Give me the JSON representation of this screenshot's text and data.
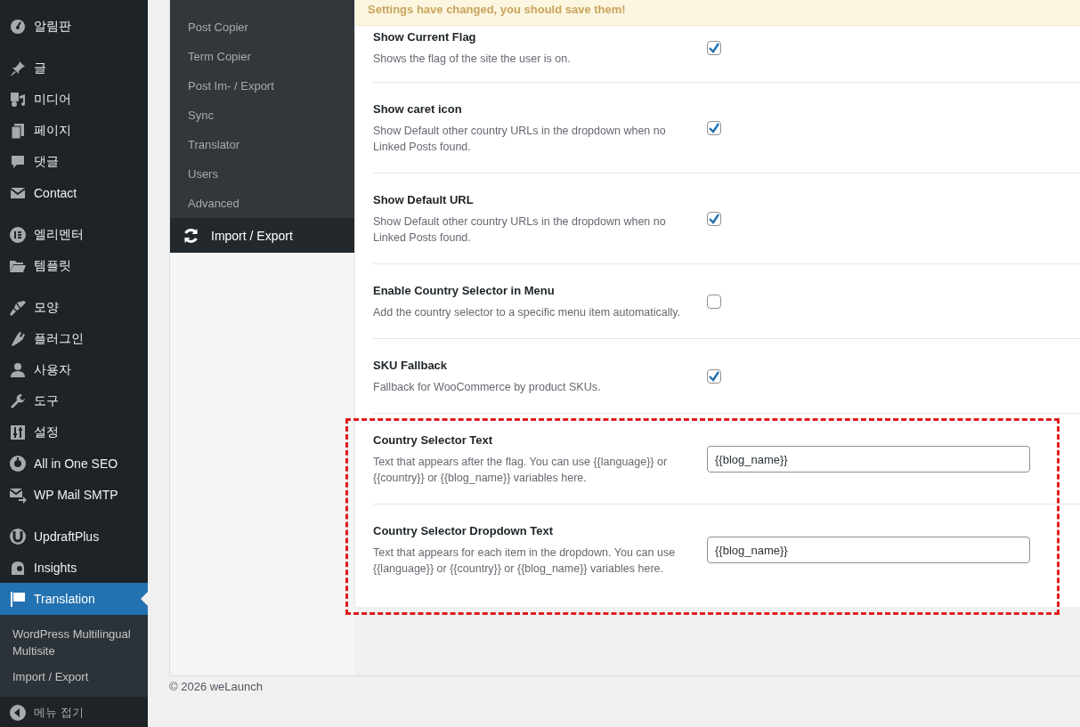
{
  "sidebar": {
    "groups": [
      [
        {
          "label": "알림판",
          "selected": false
        }
      ],
      [
        {
          "label": "글",
          "selected": false
        },
        {
          "label": "미디어",
          "selected": false
        },
        {
          "label": "페이지",
          "selected": false
        },
        {
          "label": "댓글",
          "selected": false
        },
        {
          "label": "Contact",
          "selected": false
        }
      ],
      [
        {
          "label": "엘리멘터",
          "selected": false
        },
        {
          "label": "템플릿",
          "selected": false
        }
      ],
      [
        {
          "label": "모양",
          "selected": false
        },
        {
          "label": "플러그인",
          "selected": false
        },
        {
          "label": "사용자",
          "selected": false
        },
        {
          "label": "도구",
          "selected": false
        },
        {
          "label": "설정",
          "selected": false
        },
        {
          "label": "All in One SEO",
          "selected": false
        },
        {
          "label": "WP Mail SMTP",
          "selected": false
        }
      ],
      [
        {
          "label": "UpdraftPlus",
          "selected": false
        },
        {
          "label": "Insights",
          "selected": false
        },
        {
          "label": "Translation",
          "selected": true,
          "submenu": [
            "WordPress Multilingual Multisite",
            "Import / Export"
          ]
        }
      ]
    ],
    "collapse": "메뉴 접기"
  },
  "plugin_nav": [
    {
      "label": "Post Copier",
      "selected": false
    },
    {
      "label": "Term Copier",
      "selected": false
    },
    {
      "label": "Post Im- / Export",
      "selected": false
    },
    {
      "label": "Sync",
      "selected": false
    },
    {
      "label": "Translator",
      "selected": false
    },
    {
      "label": "Users",
      "selected": false
    },
    {
      "label": "Advanced",
      "selected": false
    },
    {
      "label": "Import / Export",
      "selected": true
    }
  ],
  "notice": "Settings have changed, you should save them!",
  "settings": [
    {
      "kind": "checkbox",
      "title": "Show Current Flag",
      "description": "Shows the flag of the site the user is on.",
      "checked": true,
      "highlighted": false
    },
    {
      "kind": "checkbox",
      "title": "Show caret icon",
      "description": "Show Default other country URLs in the dropdown when no Linked Posts found.",
      "checked": true,
      "highlighted": false
    },
    {
      "kind": "checkbox",
      "title": "Show Default URL",
      "description": "Show Default other country URLs in the dropdown when no Linked Posts found.",
      "checked": true,
      "highlighted": false
    },
    {
      "kind": "checkbox",
      "title": "Enable Country Selector in Menu",
      "description": "Add the country selector to a specific menu item automatically.",
      "checked": false,
      "highlighted": false
    },
    {
      "kind": "checkbox",
      "title": "SKU Fallback",
      "description": "Fallback for WooCommerce by product SKUs.",
      "checked": true,
      "highlighted": false
    },
    {
      "kind": "text",
      "title": "Country Selector Text",
      "description": "Text that appears after the flag. You can use {{language}} or {{country}} or {{blog_name}} variables here.",
      "value": "{{blog_name}}",
      "highlighted": true
    },
    {
      "kind": "text",
      "title": "Country Selector Dropdown Text",
      "description": "Text that appears for each item in the dropdown. You can use {{language}} or {{country}} or {{blog_name}} variables here.",
      "value": "{{blog_name}}",
      "highlighted": true
    }
  ],
  "footer": "© 2026 weLaunch"
}
